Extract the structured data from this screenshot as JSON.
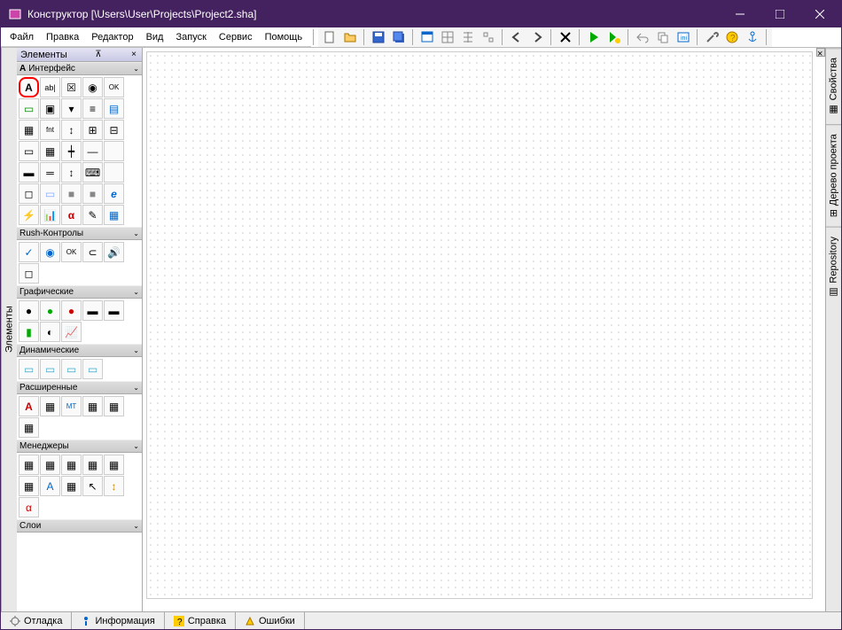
{
  "window": {
    "title": "Конструктор [\\Users\\User\\Projects\\Project2.sha]"
  },
  "menu": {
    "file": "Файл",
    "edit": "Правка",
    "editor": "Редактор",
    "view": "Вид",
    "run": "Запуск",
    "service": "Сервис",
    "help": "Помощь"
  },
  "palette": {
    "title": "Элементы",
    "tab_label": "Элементы",
    "sections": {
      "interface": "Интерфейс",
      "rush": "Rush-Контролы",
      "graphic": "Графические",
      "dynamic": "Динамические",
      "extended": "Расширенные",
      "managers": "Менеджеры",
      "layers": "Слои"
    },
    "items": {
      "label": "A",
      "edit": "ab|",
      "checkbox": "☒",
      "radio": "◉",
      "button_ok": "OK",
      "panel": "▭",
      "groupbox": "▣",
      "combo": "▾",
      "listbox": "≡",
      "memo": "▤",
      "image": "▦",
      "font": "fnt",
      "scroll": "↕",
      "tree": "⊞",
      "grid": "⊟",
      "tab": "▭",
      "table": "▦",
      "splitter": "┿",
      "slider": "—",
      "progress": "▬",
      "track": "═",
      "spin": "↕",
      "hotkey": "⌨",
      "shape": "◻",
      "bevel": "▭",
      "rect": "■",
      "browser": "e",
      "flash": "⚡",
      "chart": "📊",
      "alpha": "α",
      "brush": "✎",
      "calendar": "▦",
      "check2": "✓",
      "radio2": "◉",
      "ok2": "OK",
      "toggle": "⊂",
      "volume": "🔊",
      "panel2": "◻",
      "led": "●",
      "led_g": "●",
      "led_r": "●",
      "bar1": "▬",
      "bar2": "▬",
      "meter": "▮",
      "dial": "◐",
      "graph": "📈",
      "layer1": "▭",
      "layer2": "▭",
      "layer3": "▭",
      "layer4": "▭",
      "label_ex": "A",
      "img_ex": "▦",
      "mt": "MT",
      "cal": "▦",
      "grid2": "▦",
      "ext1": "▦",
      "mgr1": "▦",
      "mgr2": "▦",
      "mgr3": "▦",
      "mgr4": "▦",
      "mgr5": "▦",
      "mgr6": "▦",
      "mgr7": "A",
      "mgr8": "▦",
      "mgr9": "↖",
      "mgr10": "↕",
      "mgr11": "α"
    }
  },
  "right_tabs": {
    "properties": "Свойства",
    "tree": "Дерево проекта",
    "repository": "Repository"
  },
  "bottom_tabs": {
    "debug": "Отладка",
    "info": "Информация",
    "help": "Справка",
    "errors": "Ошибки"
  }
}
